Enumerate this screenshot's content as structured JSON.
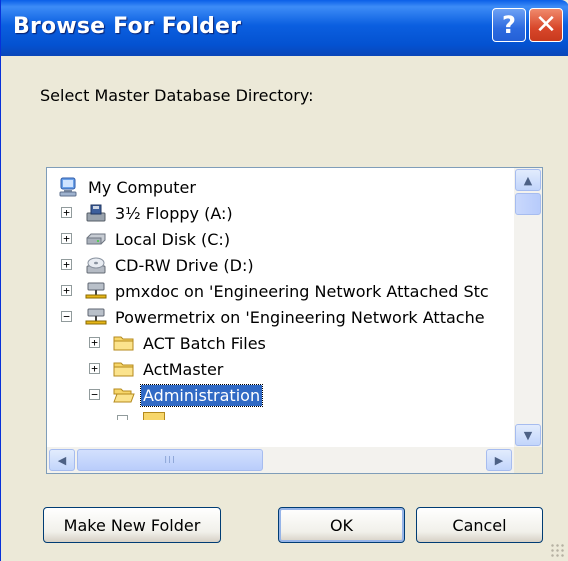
{
  "window": {
    "title": "Browse For Folder",
    "help_label": "?",
    "close_label": "✕"
  },
  "prompt": "Select Master Database Directory:",
  "tree": [
    {
      "label": "My Computer",
      "icon": "computer-icon",
      "expander": "",
      "selected": false
    },
    {
      "label": "3½ Floppy (A:)",
      "icon": "floppy-drive-icon",
      "expander": "+",
      "selected": false
    },
    {
      "label": "Local Disk (C:)",
      "icon": "hard-disk-icon",
      "expander": "+",
      "selected": false
    },
    {
      "label": "CD-RW Drive (D:)",
      "icon": "cd-drive-icon",
      "expander": "+",
      "selected": false
    },
    {
      "label": "pmxdoc on 'Engineering Network Attached Stc",
      "icon": "network-drive-icon",
      "expander": "+",
      "selected": false
    },
    {
      "label": "Powermetrix on 'Engineering Network Attache",
      "icon": "network-drive-icon",
      "expander": "−",
      "selected": false
    },
    {
      "label": "ACT Batch Files",
      "icon": "folder-icon",
      "expander": "+",
      "selected": false
    },
    {
      "label": "ActMaster",
      "icon": "folder-icon",
      "expander": "+",
      "selected": false
    },
    {
      "label": "Administration",
      "icon": "folder-open-icon",
      "expander": "−",
      "selected": true
    }
  ],
  "scroll": {
    "up": "▲",
    "down": "▼",
    "left": "◀",
    "right": "▶",
    "thumb_grip": "III"
  },
  "buttons": {
    "make_new_folder": "Make New Folder",
    "ok": "OK",
    "cancel": "Cancel"
  },
  "colors": {
    "title_bar": "#0a5fe8",
    "selection": "#316ac5",
    "dialog_bg": "#ece9d8"
  }
}
